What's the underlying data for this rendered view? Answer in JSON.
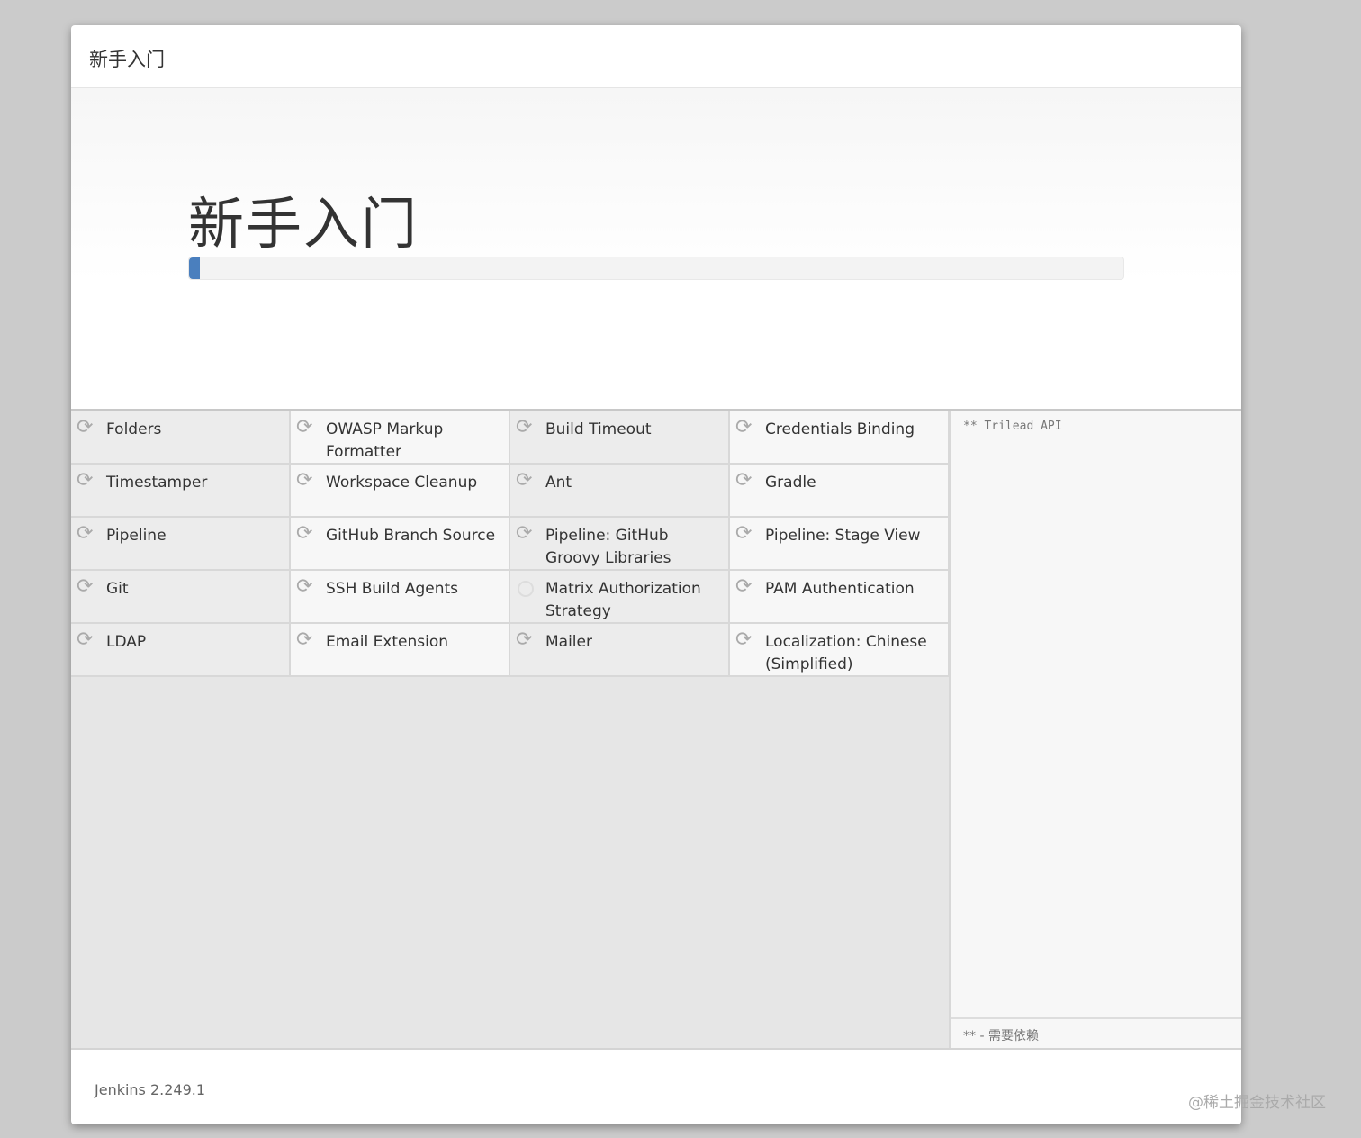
{
  "header": {
    "title": "新手入门"
  },
  "hero": {
    "title": "新手入门",
    "progress_percent": 1.2
  },
  "plugins": [
    {
      "name": "Folders",
      "status": "installing"
    },
    {
      "name": "OWASP Markup Formatter",
      "status": "installing"
    },
    {
      "name": "Build Timeout",
      "status": "installing"
    },
    {
      "name": "Credentials Binding",
      "status": "installing"
    },
    {
      "name": "Timestamper",
      "status": "installing"
    },
    {
      "name": "Workspace Cleanup",
      "status": "installing"
    },
    {
      "name": "Ant",
      "status": "installing"
    },
    {
      "name": "Gradle",
      "status": "installing"
    },
    {
      "name": "Pipeline",
      "status": "installing"
    },
    {
      "name": "GitHub Branch Source",
      "status": "installing"
    },
    {
      "name": "Pipeline: GitHub Groovy Libraries",
      "status": "installing"
    },
    {
      "name": "Pipeline: Stage View",
      "status": "installing"
    },
    {
      "name": "Git",
      "status": "installing"
    },
    {
      "name": "SSH Build Agents",
      "status": "installing"
    },
    {
      "name": "Matrix Authorization Strategy",
      "status": "pending"
    },
    {
      "name": "PAM Authentication",
      "status": "installing"
    },
    {
      "name": "LDAP",
      "status": "installing"
    },
    {
      "name": "Email Extension",
      "status": "installing"
    },
    {
      "name": "Mailer",
      "status": "installing"
    },
    {
      "name": "Localization: Chinese (Simplified)",
      "status": "installing"
    }
  ],
  "log": {
    "text": "** Trilead API",
    "legend": "** - 需要依赖"
  },
  "footer": {
    "version": "Jenkins 2.249.1"
  },
  "watermark": "@稀土掘金技术社区"
}
